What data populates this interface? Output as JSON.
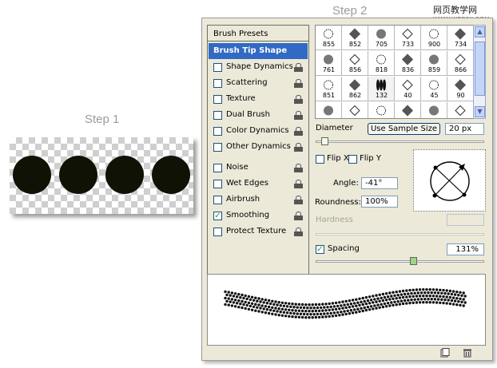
{
  "steps": {
    "step1_label": "Step 1",
    "step2_label": "Step 2"
  },
  "watermark": {
    "title": "网页教学网",
    "url": "WWW.WEB3X.COM"
  },
  "step1": {
    "dot_count": 4,
    "dot_color": "#101206"
  },
  "panel": {
    "brush_presets_label": "Brush Presets",
    "brush_tip_shape_label": "Brush Tip Shape",
    "options": [
      {
        "label": "Shape Dynamics",
        "checked": false,
        "mark": ""
      },
      {
        "label": "Scattering",
        "checked": false,
        "mark": ""
      },
      {
        "label": "Texture",
        "checked": false,
        "mark": ""
      },
      {
        "label": "Dual Brush",
        "checked": false,
        "mark": ""
      },
      {
        "label": "Color Dynamics",
        "checked": false,
        "mark": ""
      },
      {
        "label": "Other Dynamics",
        "checked": false,
        "mark": ""
      },
      {
        "label": "Noise",
        "checked": false,
        "mark": ""
      },
      {
        "label": "Wet Edges",
        "checked": false,
        "mark": ""
      },
      {
        "label": "Airbrush",
        "checked": false,
        "mark": ""
      },
      {
        "label": "Smoothing",
        "checked": true,
        "mark": "✓"
      },
      {
        "label": "Protect Texture",
        "checked": false,
        "mark": ""
      }
    ],
    "brush_grid": {
      "rows": [
        [
          "855",
          "852",
          "705",
          "733",
          "900",
          "734"
        ],
        [
          "761",
          "856",
          "818",
          "836",
          "859",
          "866"
        ],
        [
          "851",
          "862",
          "132",
          "40",
          "45",
          "90"
        ],
        [
          "",
          "",
          "",
          "",
          "",
          ""
        ]
      ]
    },
    "diameter": {
      "label": "Diameter",
      "sample_button": "Use Sample Size",
      "value": "20 px",
      "slider_fraction": 0.05
    },
    "flip": {
      "x_label": "Flip X",
      "y_label": "Flip Y",
      "x_checked": false,
      "y_checked": false
    },
    "angle": {
      "label": "Angle:",
      "value": "-41°"
    },
    "roundness": {
      "label": "Roundness:",
      "value": "100%"
    },
    "hardness": {
      "label": "Hardness",
      "value": ""
    },
    "spacing": {
      "label": "Spacing",
      "checked": true,
      "mark": "✓",
      "value": "131%",
      "slider_fraction": 0.58
    },
    "accent_color": "#316ac5"
  }
}
